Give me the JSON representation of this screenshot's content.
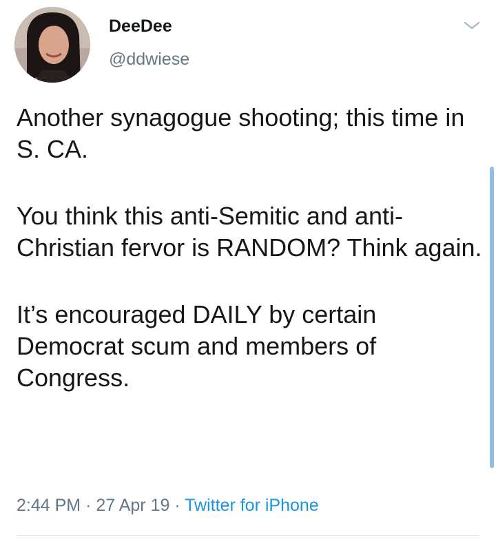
{
  "user": {
    "display_name": "DeeDee",
    "handle": "@ddwiese"
  },
  "tweet": {
    "paragraphs": [
      "Another synagogue shooting; this time in S. CA.",
      "You think this anti-Semitic and anti-Christian fervor is RANDOM? Think again.",
      "It’s encouraged DAILY by certain Democrat scum and members of Congress."
    ]
  },
  "meta": {
    "time": "2:44 PM",
    "separator": "·",
    "date": "27 Apr 19",
    "source": "Twitter for iPhone"
  },
  "colors": {
    "text": "#14171a",
    "secondary": "#657786",
    "link": "#1b95e0",
    "divider": "#e1e8ed"
  },
  "icons": {
    "menu": "chevron-down-icon",
    "avatar": "profile-photo"
  }
}
